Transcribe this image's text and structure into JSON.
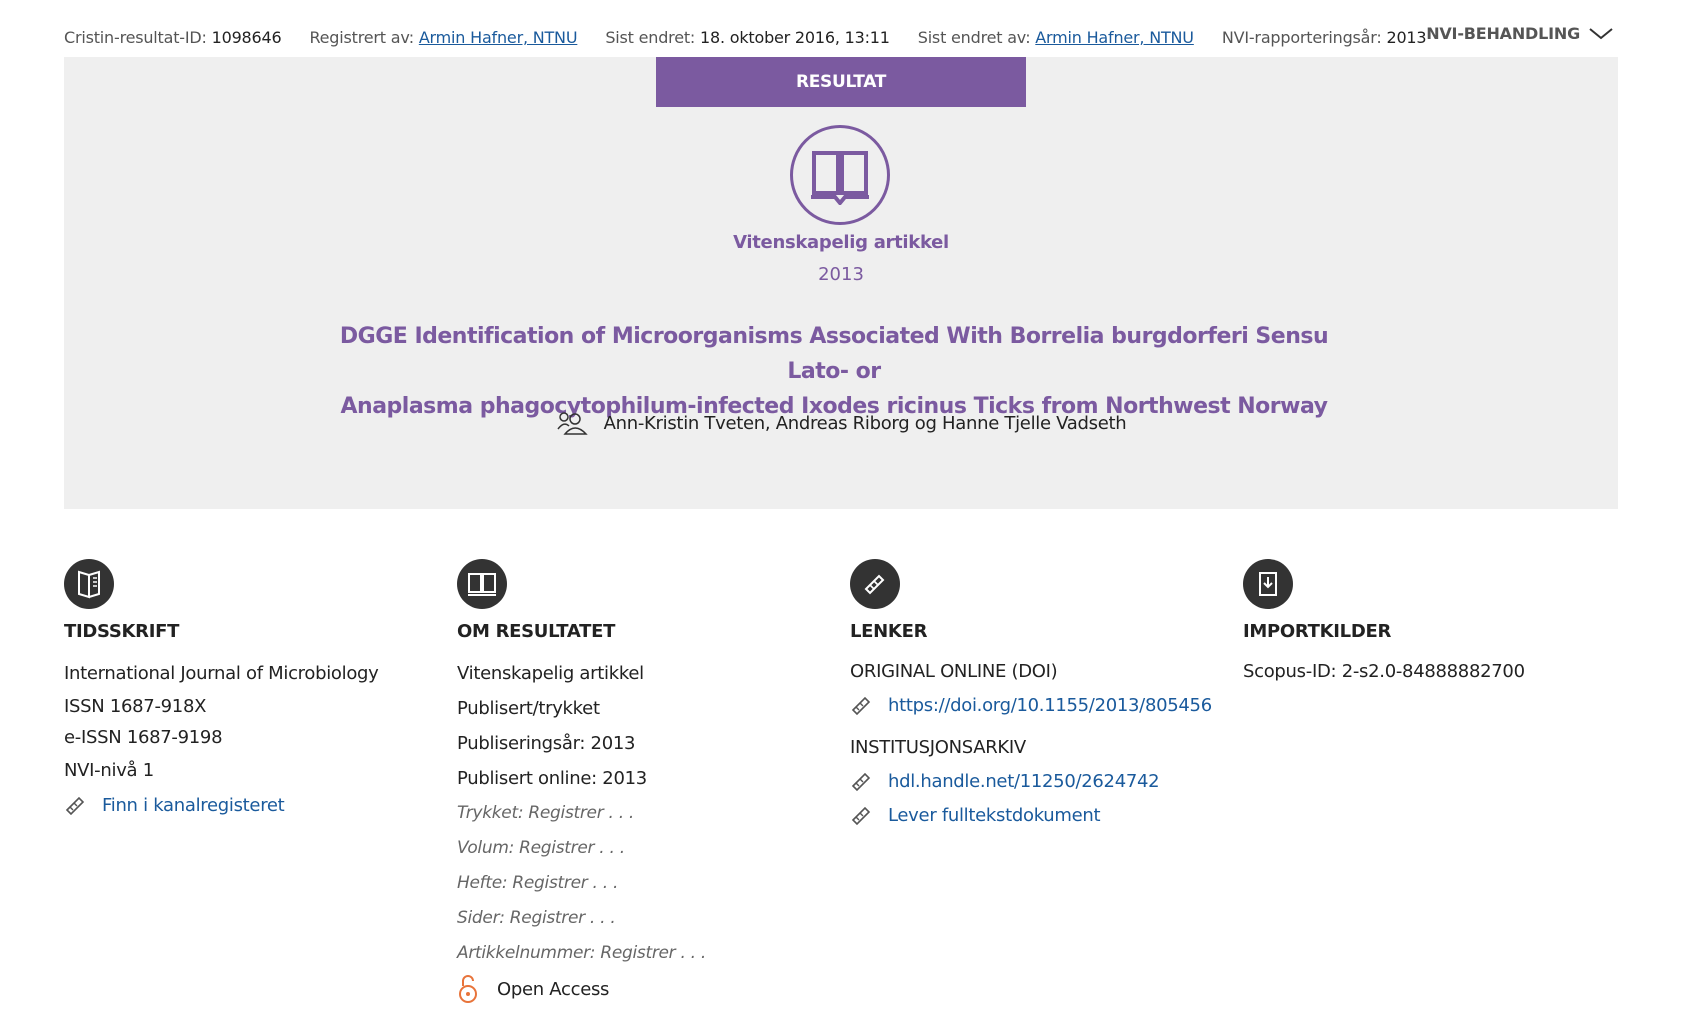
{
  "meta": {
    "cristin_id_label": "Cristin-resultat-ID:",
    "cristin_id": "1098646",
    "registered_by_label": "Registrert av:",
    "registered_by": "Armin Hafner, NTNU",
    "last_changed_label": "Sist endret:",
    "last_changed": "18. oktober 2016, 13:11",
    "last_changed_by_label": "Sist endret av:",
    "last_changed_by": "Armin Hafner, NTNU",
    "nvi_year_label": "NVI-rapporteringsår:",
    "nvi_year": "2013",
    "nvi_toggle": "NVI-BEHANDLING"
  },
  "hero": {
    "tab_label": "RESULTAT",
    "type_icon": "open-book-icon",
    "type_label": "Vitenskapelig artikkel",
    "year": "2013",
    "title_line1": "DGGE Identification of Microorganisms Associated With Borrelia burgdorferi Sensu Lato- or",
    "title_line2": "Anaplasma phagocytophilum-infected Ixodes ricinus Ticks from Northwest Norway",
    "authors": "Ann-Kristin Tveten, Andreas Riborg og Hanne Tjelle Vadseth"
  },
  "journal": {
    "heading": "TIDSSKRIFT",
    "name": "International Journal of Microbiology",
    "issn": "ISSN 1687-918X",
    "eissn": "e-ISSN 1687-9198",
    "nvi_level": "NVI-nivå 1",
    "link": "Finn i kanalregisteret"
  },
  "about": {
    "heading": "OM RESULTATET",
    "type": "Vitenskapelig artikkel",
    "status": "Publisert/trykket",
    "pub_year": "Publiseringsår: 2013",
    "online": "Publisert online: 2013",
    "printed": "Trykket:  Registrer . . .",
    "volume": "Volum:  Registrer . . .",
    "issue": "Hefte:  Registrer . . .",
    "pages": "Sider: Registrer . . .",
    "article_no": "Artikkelnummer:  Registrer . . .",
    "open_access": "Open Access"
  },
  "links": {
    "heading": "LENKER",
    "doi_heading": "ORIGINAL ONLINE (DOI)",
    "doi_url": "https://doi.org/10.1155/2013/805456",
    "archive_heading": "INSTITUSJONSARKIV",
    "archive_url": "hdl.handle.net/11250/2624742",
    "fulltext": "Lever fulltekstdokument"
  },
  "import": {
    "heading": "IMPORTKILDER",
    "scopus": "Scopus-ID: 2-s2.0-84888882700"
  },
  "colors": {
    "accent": "#7b5aa0",
    "link": "#1a5a9c",
    "hero_bg": "#efefef",
    "open_access": "#e8743b"
  }
}
